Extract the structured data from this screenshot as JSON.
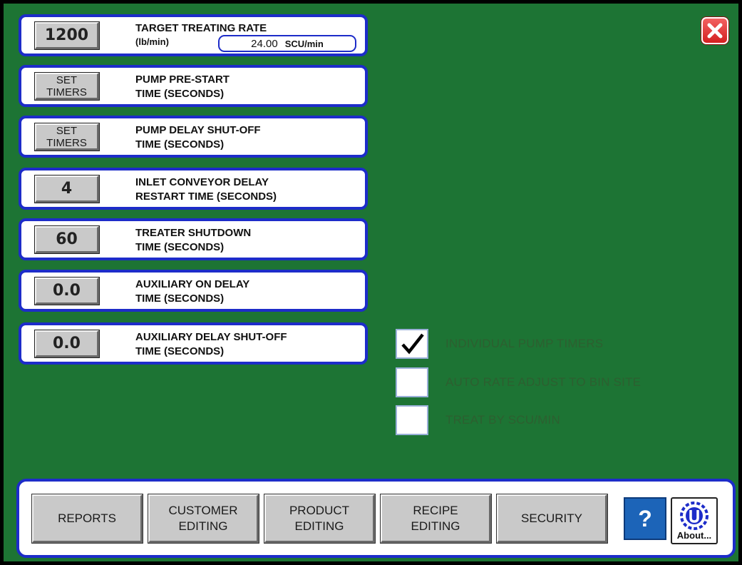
{
  "settings": [
    {
      "value": "1200",
      "label1": "TARGET TREATING RATE",
      "units": "(lb/min)",
      "rate_value": "24.00",
      "rate_units": "SCU/min"
    },
    {
      "value1": "SET",
      "value2": "TIMERS",
      "label1": "PUMP PRE-START",
      "label2": "TIME (SECONDS)"
    },
    {
      "value1": "SET",
      "value2": "TIMERS",
      "label1": "PUMP DELAY SHUT-OFF",
      "label2": "TIME (SECONDS)"
    },
    {
      "value": "4",
      "label1": "INLET CONVEYOR DELAY",
      "label2": "RESTART TIME (SECONDS)"
    },
    {
      "value": "60",
      "label1": "TREATER SHUTDOWN",
      "label2": "TIME (SECONDS)"
    },
    {
      "value": "0.0",
      "label1": "AUXILIARY ON DELAY",
      "label2": "TIME (SECONDS)"
    },
    {
      "value": "0.0",
      "label1": "AUXILIARY DELAY SHUT-OFF",
      "label2": "TIME (SECONDS)"
    }
  ],
  "options": [
    {
      "label": "INDIVIDUAL PUMP TIMERS",
      "checked": true
    },
    {
      "label": "AUTO RATE ADJUST TO BIN SITE",
      "checked": false
    },
    {
      "label": "TREAT BY SCU/min",
      "checked": false
    }
  ],
  "nav": [
    {
      "line1": "REPORTS",
      "line2": ""
    },
    {
      "line1": "CUSTOMER",
      "line2": "EDITING"
    },
    {
      "line1": "PRODUCT",
      "line2": "EDITING"
    },
    {
      "line1": "RECIPE",
      "line2": "EDITING"
    },
    {
      "line1": "SECURITY",
      "line2": ""
    }
  ],
  "help": {
    "label": "?"
  },
  "about": {
    "label": "About..."
  },
  "colors": {
    "background": "#1d7434",
    "border": "#1d2cc9",
    "button": "#c9c9c9",
    "close": "#d42020"
  }
}
